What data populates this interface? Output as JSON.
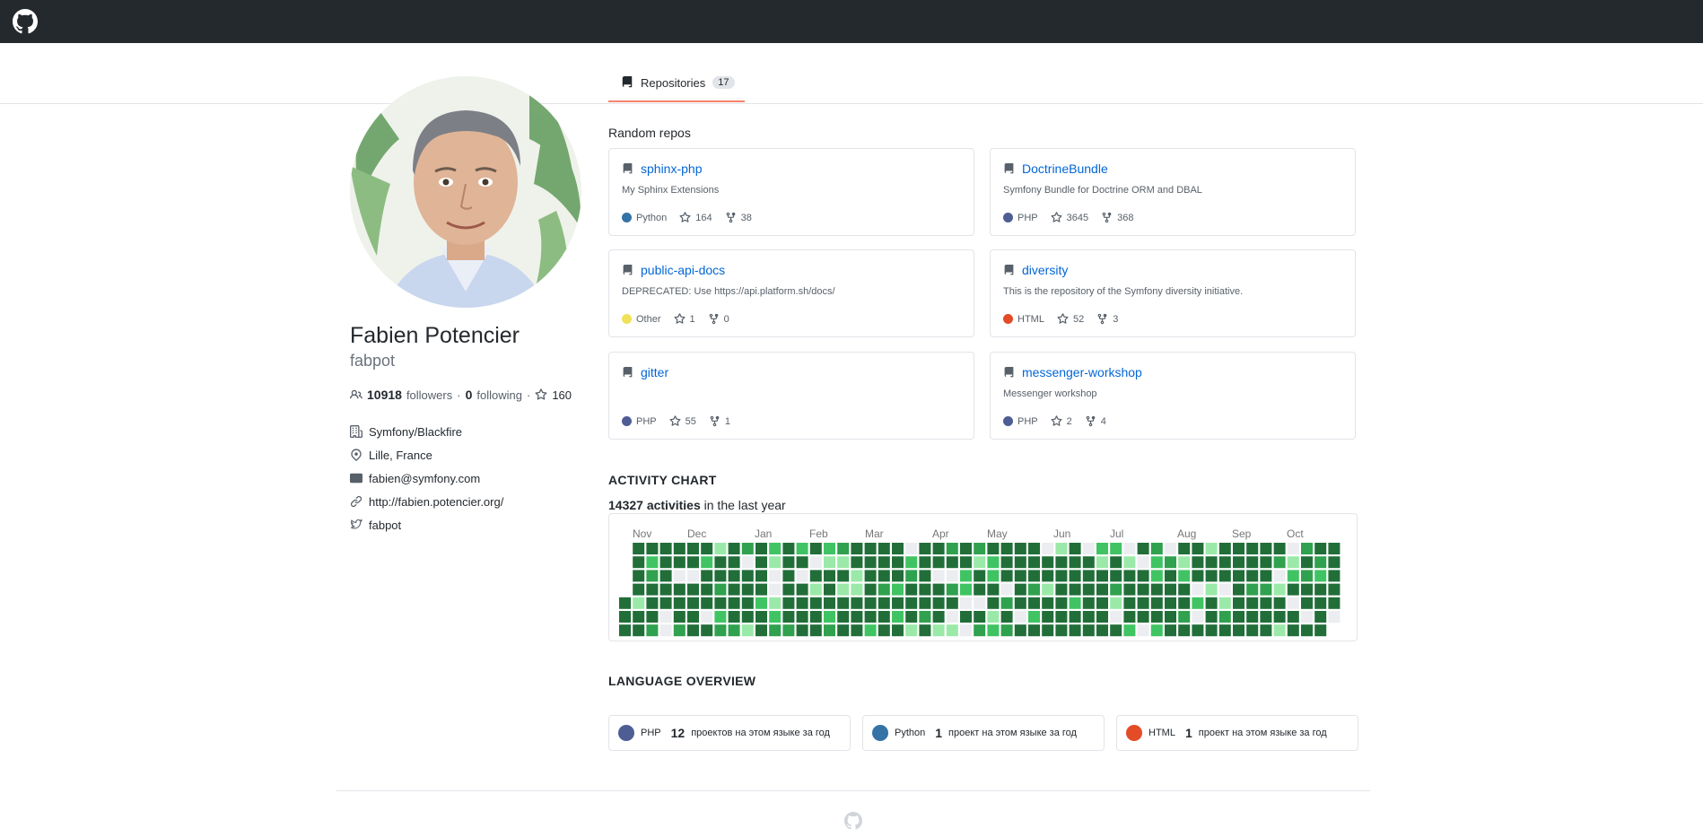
{
  "nav": {
    "logo_icon": "github-mark-icon"
  },
  "tabs": [
    {
      "label": "Repositories",
      "count": "17",
      "icon": "repo-icon"
    }
  ],
  "profile": {
    "name": "Fabien Potencier",
    "login": "fabpot",
    "followers_count": "10918",
    "followers_label": "followers",
    "separator": "·",
    "following_count": "0",
    "following_label": "following",
    "stars_count": "160",
    "company": "Symfony/Blackfire",
    "location": "Lille, France",
    "email": "fabien@symfony.com",
    "website": "http://fabien.potencier.org/",
    "twitter": "fabpot"
  },
  "random_repos": {
    "heading": "Random repos",
    "repos": [
      {
        "name": "sphinx-php",
        "description": "My Sphinx Extensions",
        "language": "Python",
        "language_color": "#3572A5",
        "stars": "164",
        "forks": "38"
      },
      {
        "name": "DoctrineBundle",
        "description": "Symfony Bundle for Doctrine ORM and DBAL",
        "language": "PHP",
        "language_color": "#4F5D95",
        "stars": "3645",
        "forks": "368"
      },
      {
        "name": "public-api-docs",
        "description": "DEPRECATED: Use https://api.platform.sh/docs/",
        "language": "Other",
        "language_color": "#f1e05a",
        "stars": "1",
        "forks": "0"
      },
      {
        "name": "diversity",
        "description": "This is the repository of the Symfony diversity initiative.",
        "language": "HTML",
        "language_color": "#e34c26",
        "stars": "52",
        "forks": "3"
      },
      {
        "name": "gitter",
        "description": "",
        "language": "PHP",
        "language_color": "#4F5D95",
        "stars": "55",
        "forks": "1"
      },
      {
        "name": "messenger-workshop",
        "description": "Messenger workshop",
        "language": "PHP",
        "language_color": "#4F5D95",
        "stars": "2",
        "forks": "4"
      }
    ]
  },
  "activity": {
    "heading": "ACTIVITY CHART",
    "total": "14327 activities",
    "suffix": " in the last year",
    "months": [
      "Nov",
      "Dec",
      "Jan",
      "Feb",
      "Mar",
      "Apr",
      "May",
      "Jun",
      "Jul",
      "Aug",
      "Sep",
      "Oct"
    ],
    "colors": {
      "high": "#216e39",
      "mid": "#30a14e",
      "low": "#40c463",
      "lowest": "#9be9a8",
      "none": "#ebedf0"
    }
  },
  "languages": {
    "heading": "LANGUAGE OVERVIEW",
    "items": [
      {
        "name": "PHP",
        "count": "12",
        "text": "проектов на этом языке за год",
        "color": "#4F5D95"
      },
      {
        "name": "Python",
        "count": "1",
        "text": "проект на этом языке за год",
        "color": "#3572A5"
      },
      {
        "name": "HTML",
        "count": "1",
        "text": "проект на этом языке за год",
        "color": "#e34c26"
      }
    ]
  }
}
